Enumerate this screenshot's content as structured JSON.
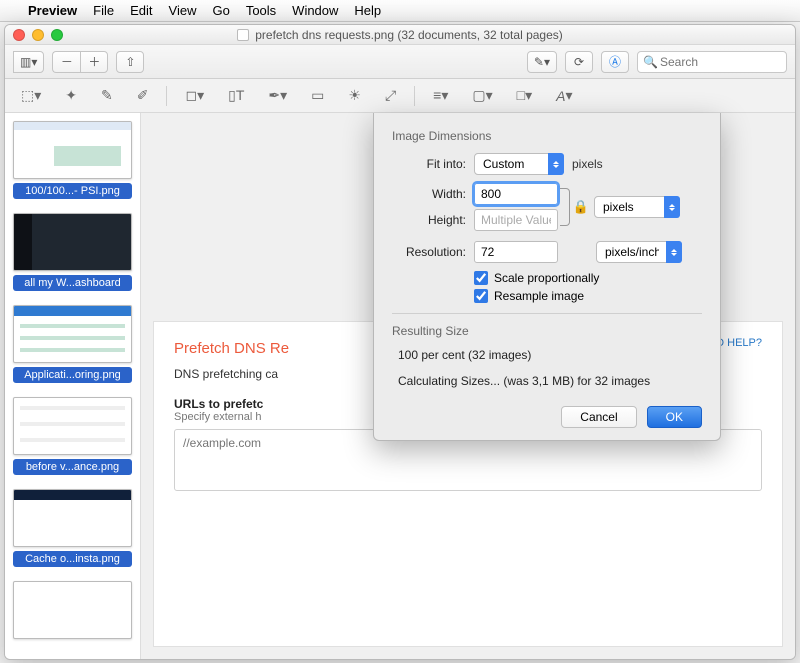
{
  "menubar": {
    "app": "Preview",
    "items": [
      "File",
      "Edit",
      "View",
      "Go",
      "Tools",
      "Window",
      "Help"
    ]
  },
  "window": {
    "title": "prefetch dns requests.png (32 documents, 32 total pages)",
    "search_placeholder": "Search"
  },
  "thumbnails": [
    {
      "label": "100/100...- PSI.png"
    },
    {
      "label": "all my W...ashboard"
    },
    {
      "label": "Applicati...oring.png"
    },
    {
      "label": "before v...ance.png"
    },
    {
      "label": "Cache o...insta.png"
    },
    {
      "label": ""
    }
  ],
  "page": {
    "heading": "Prefetch DNS Re",
    "desc": "DNS prefetching ca",
    "field_label": "URLs to prefetc",
    "field_hint": "Specify external h",
    "placeholder": "//example.com",
    "need_help": "NEED HELP?"
  },
  "dialog": {
    "section1": "Image Dimensions",
    "fit_label": "Fit into:",
    "fit_value": "Custom",
    "fit_unit": "pixels",
    "width_label": "Width:",
    "width_value": "800",
    "height_label": "Height:",
    "height_value": "Multiple Values",
    "dim_unit": "pixels",
    "res_label": "Resolution:",
    "res_value": "72",
    "res_unit": "pixels/inch",
    "scale_cb": "Scale proportionally",
    "resample_cb": "Resample image",
    "section2": "Resulting Size",
    "result_line1": "100 per cent (32 images)",
    "result_line2": "Calculating Sizes... (was 3,1 MB) for 32 images",
    "cancel": "Cancel",
    "ok": "OK"
  }
}
